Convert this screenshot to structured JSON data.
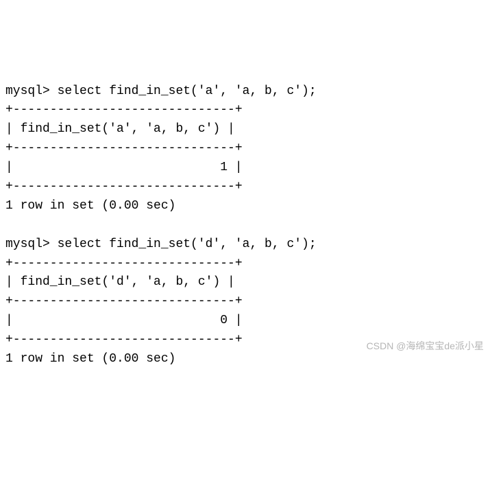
{
  "terminal": {
    "prompt": "mysql>",
    "query1": {
      "command_line": "mysql> select find_in_set('a', 'a, b, c');",
      "table_border": "+------------------------------+",
      "header_row": "| find_in_set('a', 'a, b, c') |",
      "value_row": "|                            1 |",
      "footer": "1 row in set (0.00 sec)"
    },
    "query2": {
      "command_line": "mysql> select find_in_set('d', 'a, b, c');",
      "table_border": "+------------------------------+",
      "header_row": "| find_in_set('d', 'a, b, c') |",
      "value_row": "|                            0 |",
      "footer": "1 row in set (0.00 sec)"
    }
  },
  "watermark": "CSDN @海绵宝宝de派小星"
}
